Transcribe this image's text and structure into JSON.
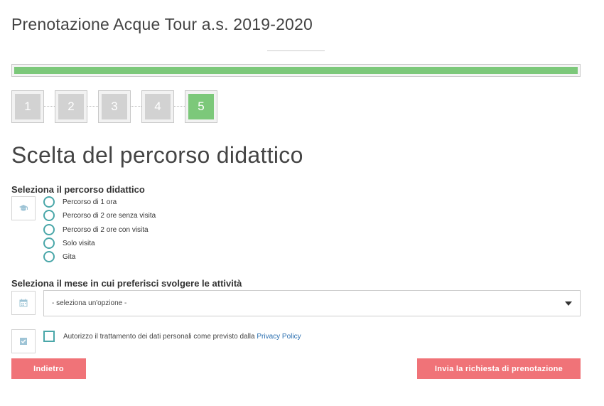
{
  "header": {
    "title": "Prenotazione Acque Tour a.s. 2019-2020"
  },
  "progress": {
    "percent": 100,
    "fill_color": "#7cc87a"
  },
  "steps": {
    "items": [
      {
        "label": "1",
        "active": false
      },
      {
        "label": "2",
        "active": false
      },
      {
        "label": "3",
        "active": false
      },
      {
        "label": "4",
        "active": false
      },
      {
        "label": "5",
        "active": true
      }
    ]
  },
  "section": {
    "title": "Scelta del percorso didattico"
  },
  "percorso": {
    "label": "Seleziona il percorso didattico",
    "icon": "graduation-cap-icon",
    "options": [
      "Percorso di 1 ora",
      "Percorso di 2 ore senza visita",
      "Percorso di 2 ore con visita",
      "Solo visita",
      "Gita"
    ]
  },
  "mese": {
    "label": "Seleziona il mese in cui preferisci svolgere le attività",
    "icon": "calendar-icon",
    "selected": "- seleziona un'opzione -"
  },
  "consent": {
    "icon": "check-square-icon",
    "text": "Autorizzo il trattamento dei dati personali come previsto dalla",
    "link": "Privacy Policy"
  },
  "buttons": {
    "back_label": "Indietro",
    "submit_label": "Invia la richiesta di prenotazione",
    "color": "#f07378"
  },
  "colors": {
    "accent": "#4aa7a9",
    "step_active": "#7cc87a",
    "step_inactive": "#d2d2d2"
  }
}
